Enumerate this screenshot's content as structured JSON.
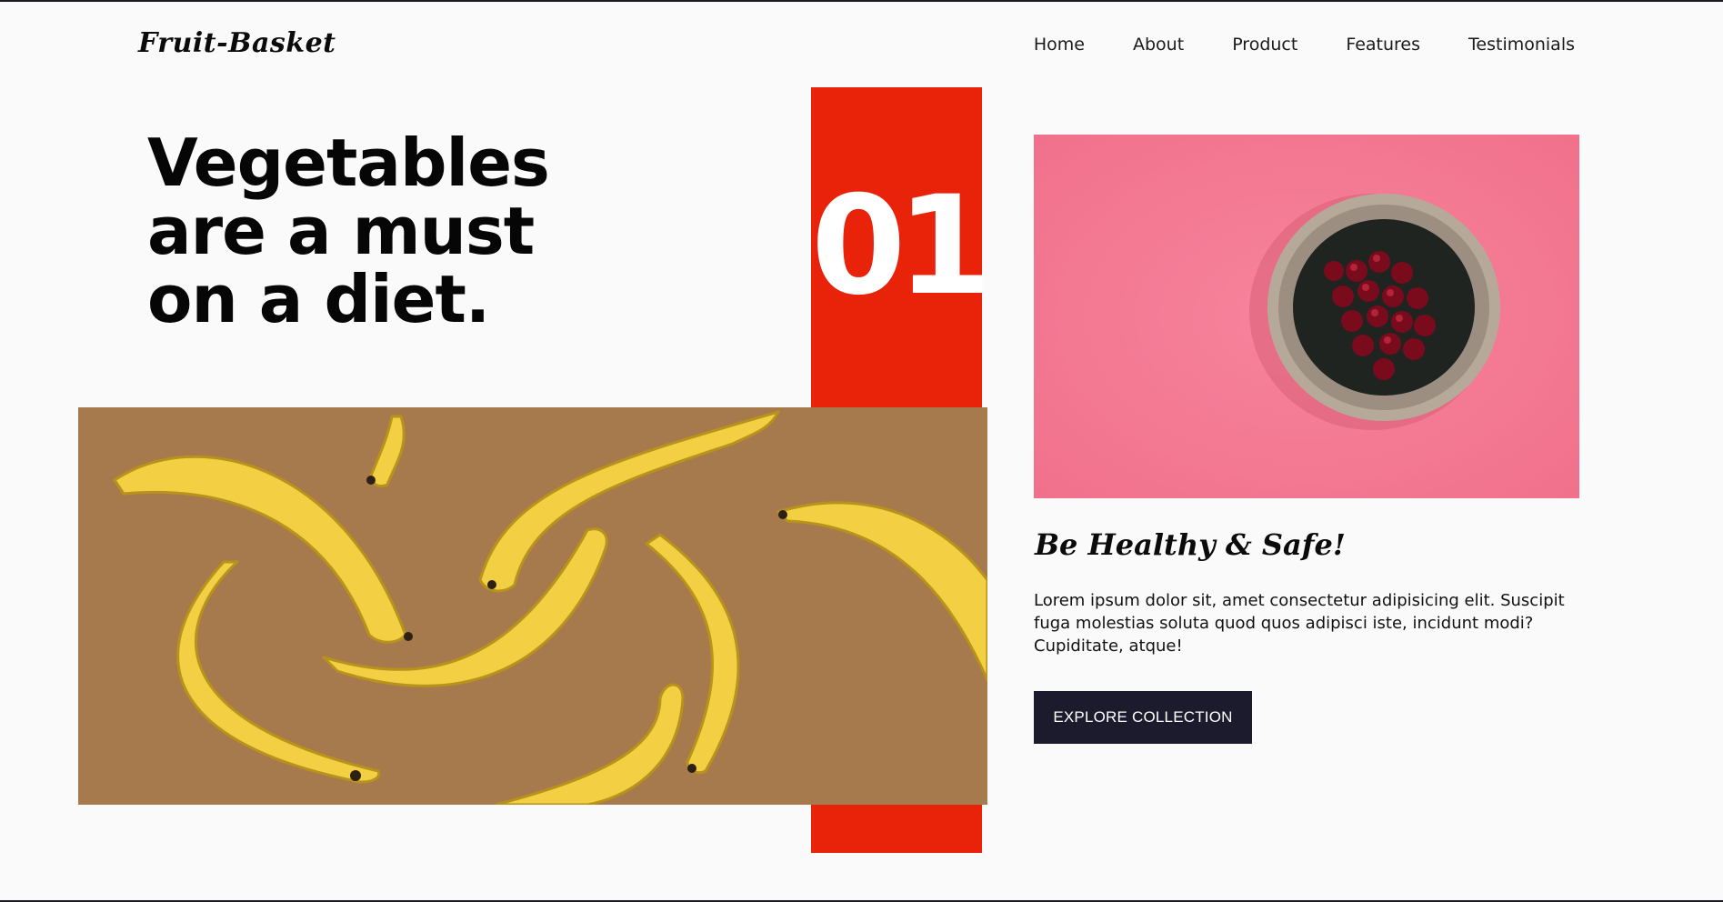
{
  "brand": {
    "logo_text": "Fruit-Basket"
  },
  "nav": {
    "items": [
      {
        "label": "Home"
      },
      {
        "label": "About"
      },
      {
        "label": "Product"
      },
      {
        "label": "Features"
      },
      {
        "label": "Testimonials"
      }
    ]
  },
  "hero": {
    "headline_lines": [
      "Vegetables",
      "are a must",
      "on a diet."
    ],
    "number": "01",
    "subheading": "Be Healthy & Safe!",
    "description": "Lorem ipsum dolor sit, amet consectetur adipisicing elit. Suscipit fuga molestias soluta quod quos adipisci iste, incidunt modi? Cupiditate, atque!",
    "cta_label": "EXPLORE COLLECTION"
  },
  "images": {
    "left": "bananas-photo",
    "right": "cherries-bowl-photo"
  },
  "colors": {
    "accent_red": "#e8230a",
    "button_bg": "#1c1b2e",
    "page_bg": "#fafafa",
    "banana_bg": "#a77a4e",
    "cherry_bg": "#f37b95"
  }
}
